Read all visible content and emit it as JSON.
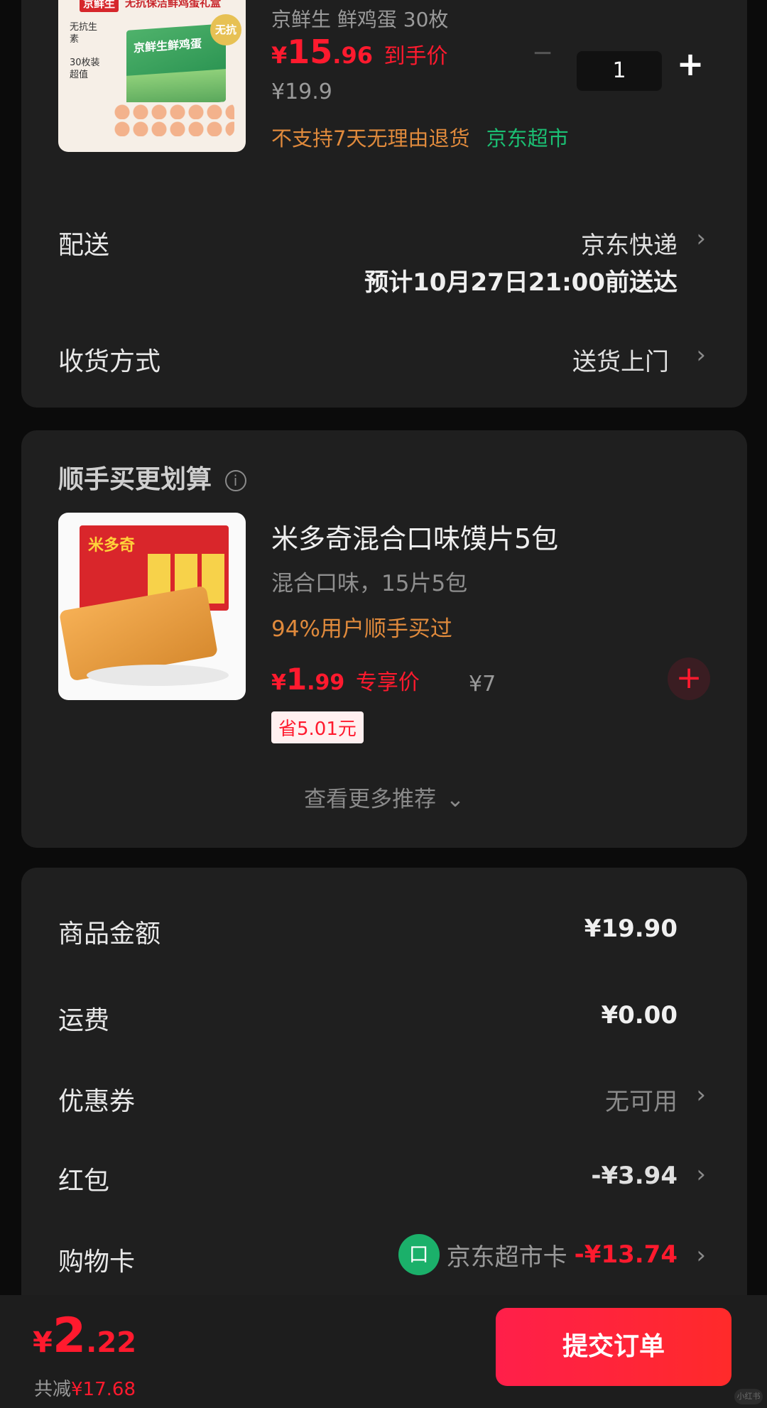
{
  "item": {
    "subtitle": "京鲜生 鲜鸡蛋 30枚",
    "price_symbol": "¥",
    "price_int": "15",
    "price_dec": ".96",
    "price_tag": "到手价",
    "orig_price": "¥19.9",
    "qty_minus": "−",
    "qty": "1",
    "qty_plus": "+",
    "no_return": "不支持7天无理由退货",
    "store": "京东超市",
    "thumb": {
      "brand": "京鲜生",
      "banner": "无抗保洁鲜鸡蛋礼盒",
      "check1": "无抗生素",
      "check2": "30枚装超值",
      "box_label": "京鲜生鲜鸡蛋",
      "seal": "无抗"
    }
  },
  "delivery": {
    "label": "配送",
    "method": "京东快递",
    "eta": "预计10月27日21:00前送达",
    "receive_label": "收货方式",
    "receive_value": "送货上门",
    "chevron": "›"
  },
  "addon": {
    "title": "顺手买更划算",
    "info_icon": "i",
    "name": "米多奇混合口味馍片5包",
    "spec": "混合口味，15片5包",
    "bought": "94%用户顺手买过",
    "price_symbol": "¥",
    "price_int": "1",
    "price_dec": ".99",
    "price_tag": "专享价",
    "orig_price": "¥7",
    "save": "省5.01元",
    "add": "+",
    "more": "查看更多推荐",
    "more_icon": "⌄",
    "thumb_brand": "米多奇"
  },
  "summary": {
    "goods_label": "商品金额",
    "goods_value": "¥19.90",
    "freight_label": "运费",
    "freight_value": "¥0.00",
    "coupon_label": "优惠券",
    "coupon_value": "无可用",
    "redpack_label": "红包",
    "redpack_value": "-¥3.94",
    "card_label": "购物卡",
    "card_name": "京东超市卡",
    "card_value": "-¥13.74",
    "card_icon": "口"
  },
  "footer": {
    "price_symbol": "¥",
    "price_int": "2",
    "price_dec": ".22",
    "saved_label": "共减",
    "saved_value": "¥17.68",
    "submit": "提交订单",
    "watermark": "小红书"
  },
  "colors": {
    "accent": "#ff1a2e",
    "orange": "#e08a3c",
    "green": "#1bbf73",
    "card": "#1f1f1f"
  }
}
